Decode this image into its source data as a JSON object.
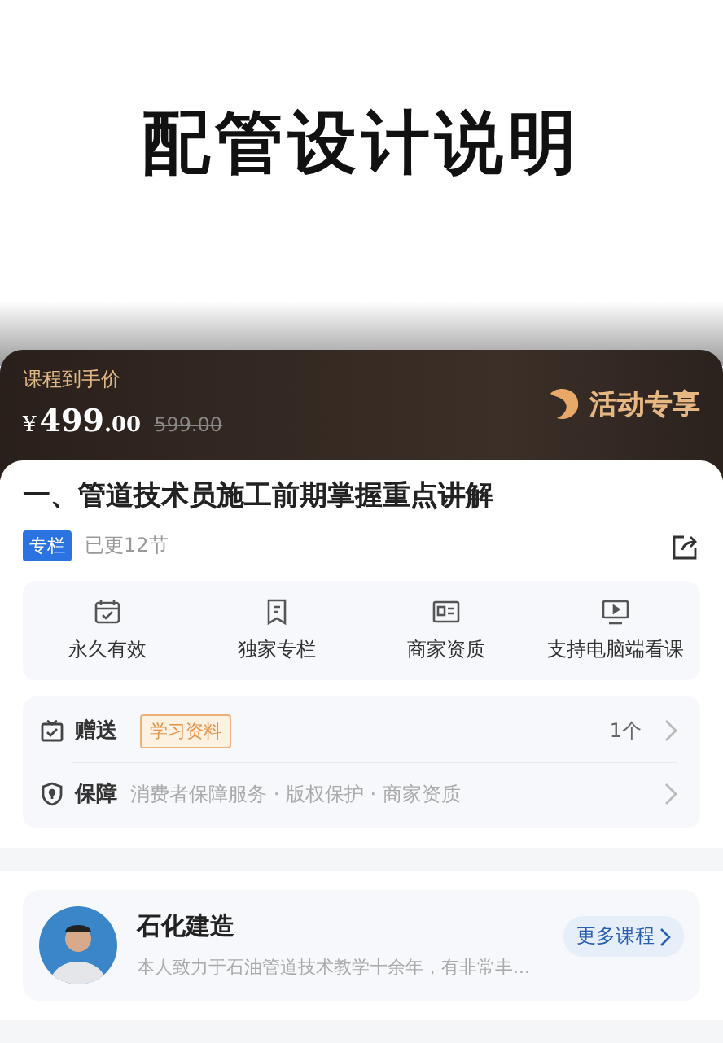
{
  "cover": {
    "title": "配管设计说明"
  },
  "price_banner": {
    "label": "课程到手价",
    "currency": "¥",
    "price_integer": "499",
    "price_decimal": ".00",
    "original_price": "599.00",
    "promo": "活动专享"
  },
  "course": {
    "title": "一、管道技术员施工前期掌握重点讲解",
    "tag": "专栏",
    "progress": "已更12节"
  },
  "features": [
    {
      "kind": "calendar",
      "label": "永久有效"
    },
    {
      "kind": "bookmark",
      "label": "独家专栏"
    },
    {
      "kind": "card",
      "label": "商家资质"
    },
    {
      "kind": "monitor",
      "label": "支持电脑端看课"
    }
  ],
  "gift": {
    "label": "赠送",
    "tag": "学习资料",
    "count": "1个"
  },
  "guarantee": {
    "label": "保障",
    "text": "消费者保障服务 · 版权保护 · 商家资质"
  },
  "teacher": {
    "name": "石化建造",
    "bio": "本人致力于石油管道技术教学十余年，有非常丰...",
    "more": "更多课程"
  }
}
